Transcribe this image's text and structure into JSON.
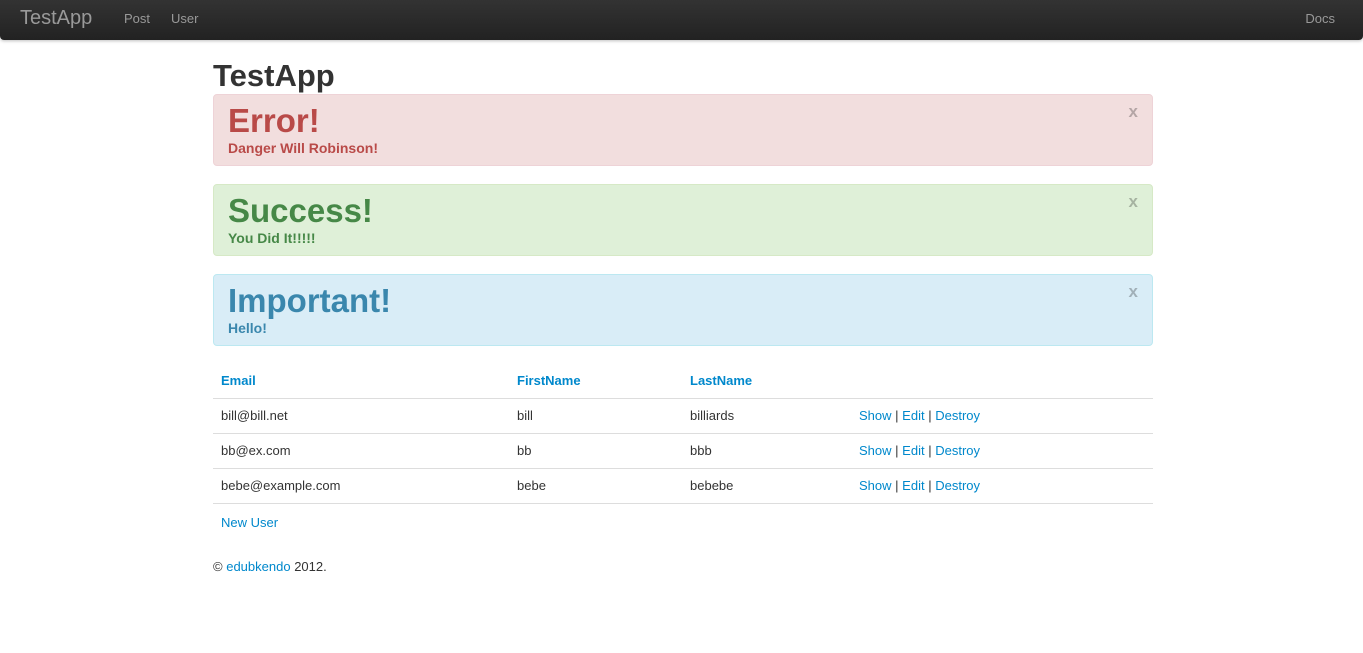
{
  "navbar": {
    "brand": "TestApp",
    "links": [
      "Post",
      "User"
    ],
    "docs": "Docs"
  },
  "page_title": "TestApp",
  "alerts": [
    {
      "heading": "Error!",
      "message": "Danger Will Robinson!",
      "close": "x",
      "type": "error"
    },
    {
      "heading": "Success!",
      "message": "You Did It!!!!!",
      "close": "x",
      "type": "success"
    },
    {
      "heading": "Important!",
      "message": "Hello!",
      "close": "x",
      "type": "info"
    }
  ],
  "table": {
    "headers": [
      "Email",
      "FirstName",
      "LastName"
    ],
    "rows": [
      {
        "email": "bill@bill.net",
        "first": "bill",
        "last": "billiards"
      },
      {
        "email": "bb@ex.com",
        "first": "bb",
        "last": "bbb"
      },
      {
        "email": "bebe@example.com",
        "first": "bebe",
        "last": "bebebe"
      }
    ],
    "actions": {
      "show": "Show",
      "edit": "Edit",
      "destroy": "Destroy",
      "separator": "|"
    }
  },
  "new_user_link": "New User",
  "footer": {
    "copyright": "©",
    "author": "edubkendo",
    "year": "2012."
  },
  "colors": {
    "link": "#0088cc",
    "error": "#b94a48",
    "success": "#468847",
    "info": "#3a87ad",
    "navbar": "#222222"
  }
}
